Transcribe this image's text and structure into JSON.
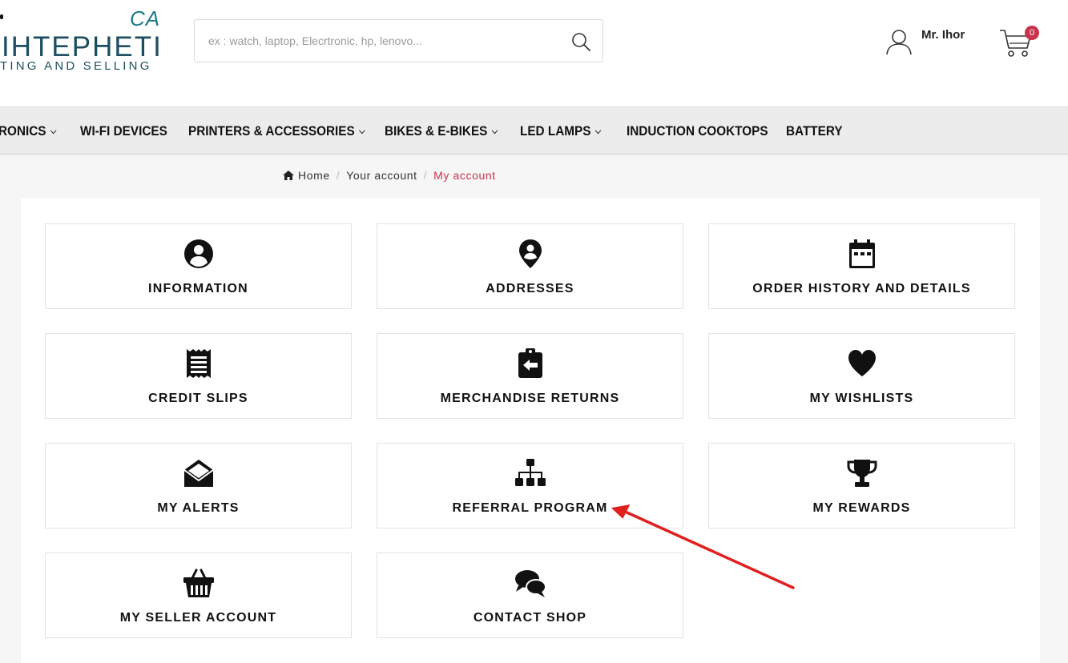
{
  "logo": {
    "ca": "CA",
    "main": "IHTEPHETI",
    "sub": "TING AND SELLING"
  },
  "search": {
    "placeholder": "ex : watch, laptop, Elecrtronic, hp, lenovo..."
  },
  "user": {
    "name": "Mr. Ihor"
  },
  "cart": {
    "count": "0"
  },
  "nav": {
    "items": [
      {
        "label": "RONICS",
        "dropdown": true
      },
      {
        "label": "WI-FI DEVICES",
        "dropdown": false
      },
      {
        "label": "PRINTERS & ACCESSORIES",
        "dropdown": true
      },
      {
        "label": "BIKES & E-BIKES",
        "dropdown": true
      },
      {
        "label": "LED LAMPS",
        "dropdown": true
      },
      {
        "label": "INDUCTION COOKTOPS",
        "dropdown": false
      },
      {
        "label": "BATTERY",
        "dropdown": false
      }
    ],
    "chevron": "⌄"
  },
  "breadcrumb": {
    "home": "Home",
    "your_account": "Your account",
    "current": "My account",
    "separator": "/"
  },
  "cards": [
    {
      "label": "INFORMATION",
      "icon": "account-circle-icon"
    },
    {
      "label": "ADDRESSES",
      "icon": "location-pin-icon"
    },
    {
      "label": "ORDER HISTORY AND DETAILS",
      "icon": "calendar-icon"
    },
    {
      "label": "CREDIT SLIPS",
      "icon": "receipt-icon"
    },
    {
      "label": "MERCHANDISE RETURNS",
      "icon": "return-clipboard-icon"
    },
    {
      "label": "MY WISHLISTS",
      "icon": "heart-icon"
    },
    {
      "label": "MY ALERTS",
      "icon": "open-envelope-icon"
    },
    {
      "label": "REFERRAL PROGRAM",
      "icon": "sitemap-icon"
    },
    {
      "label": "MY REWARDS",
      "icon": "trophy-icon"
    },
    {
      "label": "MY SELLER ACCOUNT",
      "icon": "basket-icon"
    },
    {
      "label": "CONTACT SHOP",
      "icon": "chat-bubbles-icon"
    }
  ],
  "colors": {
    "accent": "#c8334d",
    "arrow": "#e0201f",
    "logo": "#1d4e5f"
  }
}
